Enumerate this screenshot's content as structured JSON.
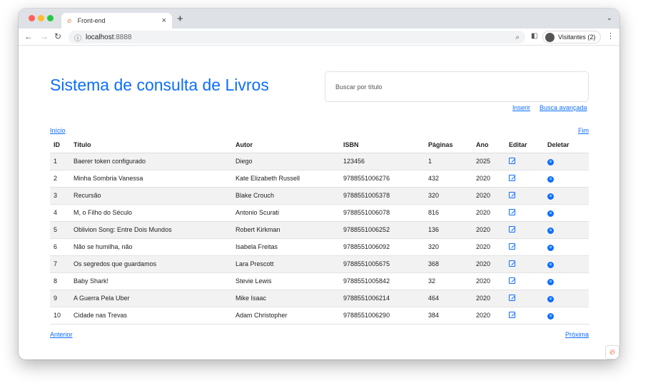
{
  "browser": {
    "tab_title": "Front-end",
    "url_host": "localhost",
    "url_port": ":8888",
    "profile": "Visitantes (2)"
  },
  "page": {
    "title": "Sistema de consulta de Livros",
    "search_placeholder": "Buscar por título",
    "insert": "Inserir",
    "advanced": "Busca avançada",
    "first": "Início",
    "last": "Fim",
    "prev": "Anterior",
    "next": "Próxima"
  },
  "table": {
    "headers": [
      "ID",
      "Título",
      "Autor",
      "ISBN",
      "Páginas",
      "Ano",
      "Editar",
      "Deletar"
    ],
    "rows": [
      [
        "1",
        "Baerer token configurado",
        "Diego",
        "123456",
        "1",
        "2025"
      ],
      [
        "2",
        "Minha Sombria Vanessa",
        "Kate Elizabeth Russell",
        "9788551006276",
        "432",
        "2020"
      ],
      [
        "3",
        "Recursão",
        "Blake Crouch",
        "9788551005378",
        "320",
        "2020"
      ],
      [
        "4",
        "M, o Filho do Século",
        "Antonio Scurati",
        "9788551006078",
        "816",
        "2020"
      ],
      [
        "5",
        "Oblivion Song: Entre Dois Mundos",
        "Robert Kirkman",
        "9788551006252",
        "136",
        "2020"
      ],
      [
        "6",
        "Não se humilha, não",
        "Isabela Freitas",
        "9788551006092",
        "320",
        "2020"
      ],
      [
        "7",
        "Os segredos que guardamos",
        "Lara Prescott",
        "9788551005675",
        "368",
        "2020"
      ],
      [
        "8",
        "Baby Shark!",
        "Stevie Lewis",
        "9788551005842",
        "32",
        "2020"
      ],
      [
        "9",
        "A Guerra Pela Uber",
        "Mike Isaac",
        "9788551006214",
        "464",
        "2020"
      ],
      [
        "10",
        "Cidade nas Trevas",
        "Adam Christopher",
        "9788551006290",
        "384",
        "2020"
      ]
    ]
  }
}
